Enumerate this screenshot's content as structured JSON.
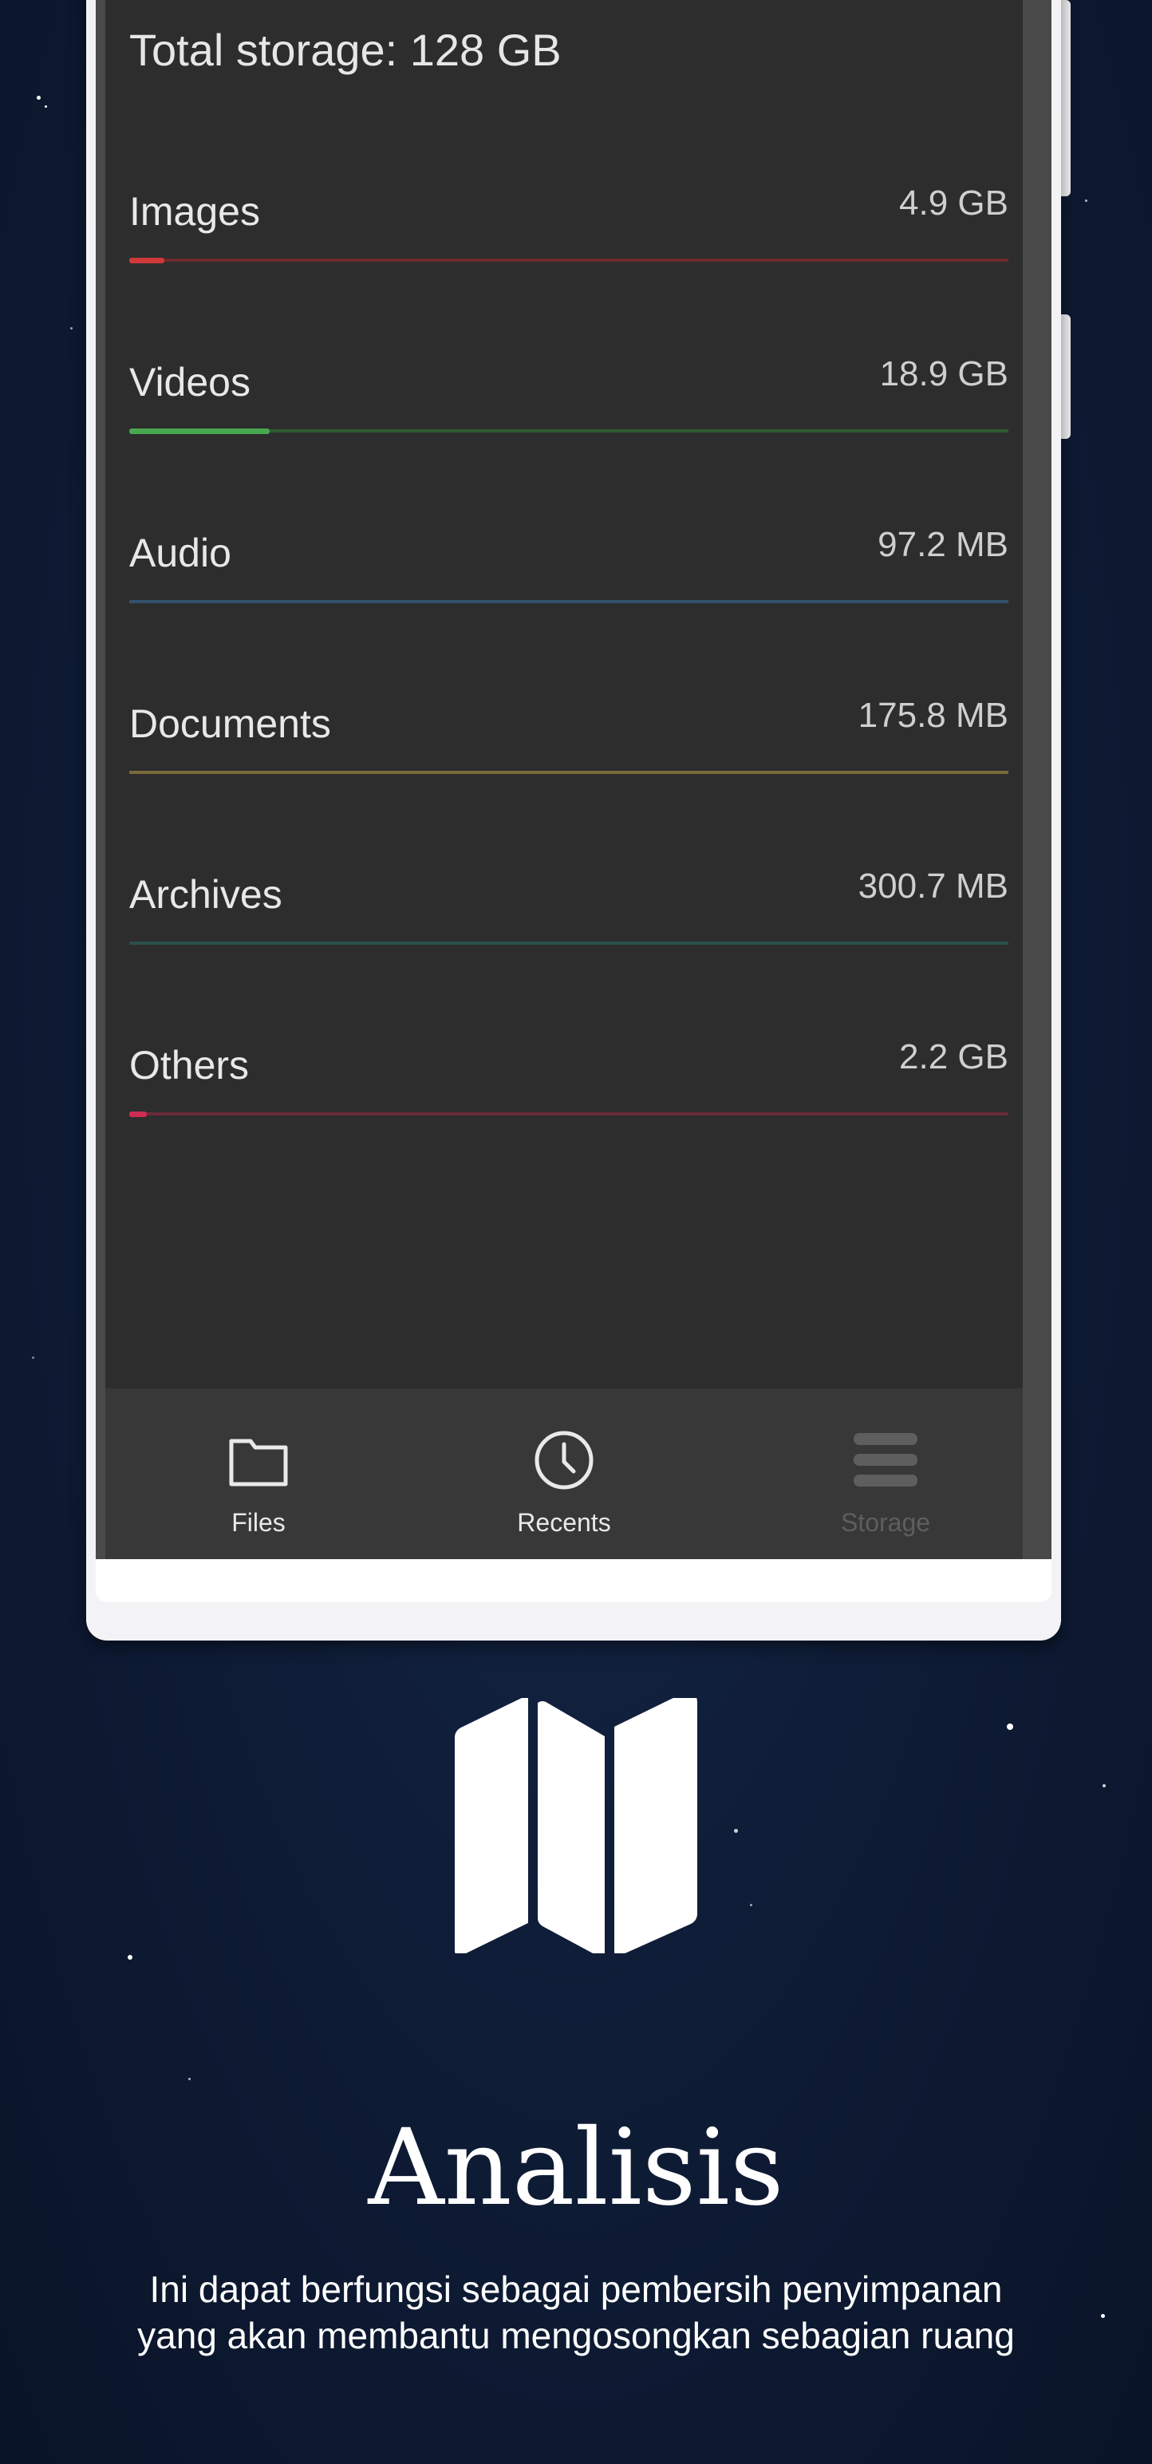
{
  "storage": {
    "total_label": "Total storage: 128 GB",
    "categories": [
      {
        "label": "Images",
        "size": "4.9 GB",
        "fill_fraction": 0.04,
        "color": "#d0383a",
        "track_color": "#6e2b2c"
      },
      {
        "label": "Videos",
        "size": "18.9 GB",
        "fill_fraction": 0.16,
        "color": "#49a84f",
        "track_color": "#2e5a31"
      },
      {
        "label": "Audio",
        "size": "97.2 MB",
        "fill_fraction": 0.0,
        "color": "#4d86c0",
        "track_color": "#33506d"
      },
      {
        "label": "Documents",
        "size": "175.8 MB",
        "fill_fraction": 0.0,
        "color": "#c9a94a",
        "track_color": "#7a6a3a"
      },
      {
        "label": "Archives",
        "size": "300.7 MB",
        "fill_fraction": 0.0,
        "color": "#2d8a78",
        "track_color": "#2b5149"
      },
      {
        "label": "Others",
        "size": "2.2 GB",
        "fill_fraction": 0.02,
        "color": "#d02c54",
        "track_color": "#6b2a3a"
      }
    ]
  },
  "nav": {
    "files_label": "Files",
    "recents_label": "Recents",
    "storage_label": "Storage",
    "active_color": "#e9e9e9",
    "inactive_color": "#5e5e5e"
  },
  "promo": {
    "title": "Analisis",
    "description_line1": "Ini dapat berfungsi sebagai pembersih penyimpanan",
    "description_line2": "yang akan membantu mengosongkan sebagian ruang"
  }
}
